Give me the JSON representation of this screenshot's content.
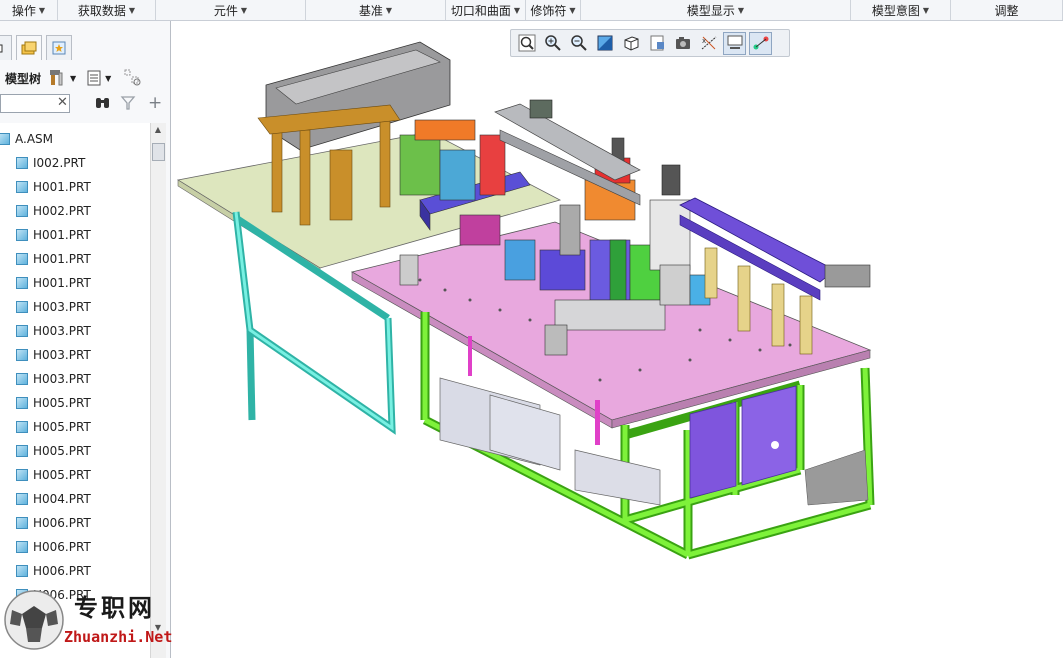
{
  "ribbon": {
    "groups": [
      {
        "label": "操作",
        "dropdown": true
      },
      {
        "label": "获取数据",
        "dropdown": true
      },
      {
        "label": "元件",
        "dropdown": true
      },
      {
        "label": "基准",
        "dropdown": true
      },
      {
        "label": "切口和曲面",
        "dropdown": true
      },
      {
        "label": "修饰符",
        "dropdown": true
      },
      {
        "label": "模型显示",
        "dropdown": true
      },
      {
        "label": "模型意图",
        "dropdown": true
      },
      {
        "label": "调整",
        "dropdown": false
      }
    ]
  },
  "left_panel": {
    "tree_title": "模型树",
    "search_value": "",
    "tree_items": [
      {
        "label": "A.ASM",
        "level": 0
      },
      {
        "label": "I002.PRT",
        "level": 1
      },
      {
        "label": "H001.PRT",
        "level": 1
      },
      {
        "label": "H002.PRT",
        "level": 1
      },
      {
        "label": "H001.PRT",
        "level": 1
      },
      {
        "label": "H001.PRT",
        "level": 1
      },
      {
        "label": "H001.PRT",
        "level": 1
      },
      {
        "label": "H003.PRT",
        "level": 1
      },
      {
        "label": "H003.PRT",
        "level": 1
      },
      {
        "label": "H003.PRT",
        "level": 1
      },
      {
        "label": "H003.PRT",
        "level": 1
      },
      {
        "label": "H005.PRT",
        "level": 1
      },
      {
        "label": "H005.PRT",
        "level": 1
      },
      {
        "label": "H005.PRT",
        "level": 1
      },
      {
        "label": "H005.PRT",
        "level": 1
      },
      {
        "label": "H004.PRT",
        "level": 1
      },
      {
        "label": "H006.PRT",
        "level": 1
      },
      {
        "label": "H006.PRT",
        "level": 1
      },
      {
        "label": "H006.PRT",
        "level": 1
      },
      {
        "label": "H006.PRT",
        "level": 1
      }
    ]
  },
  "view_toolbar": {
    "buttons": [
      "refit-icon",
      "zoom-in-icon",
      "zoom-out-icon",
      "repaint-icon",
      "display-style-icon",
      "saved-orientations-icon",
      "view-manager-icon",
      "datum-display-icon",
      "spin-center-icon",
      "annotation-display-icon"
    ]
  },
  "watermark": {
    "title": "专职网",
    "url": "Zhuanzhi.Net"
  },
  "colors": {
    "table_pink": "#e6a6dd",
    "table_light": "#dfe8c0",
    "frame_green": "#66dd22",
    "frame_teal": "#3cd3c4",
    "panel_purple": "#8b63e6",
    "slide_blue": "#6f4fd8"
  }
}
